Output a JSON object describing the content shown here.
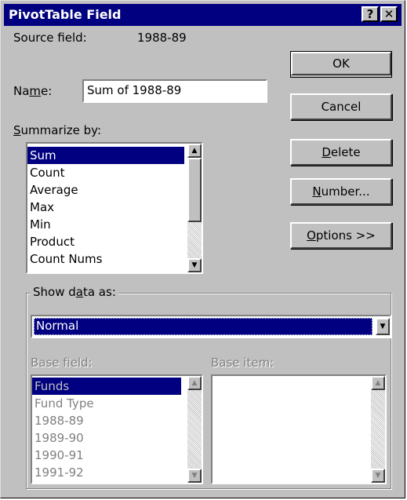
{
  "dialog": {
    "title": "PivotTable Field",
    "help_label": "?",
    "close_label": "✕"
  },
  "source": {
    "label": "Source field:",
    "value": "1988-89"
  },
  "name": {
    "label_pre": "Na",
    "label_key": "m",
    "label_post": "e:",
    "value": "Sum of 1988-89"
  },
  "summarize": {
    "label_key": "S",
    "label_post": "ummarize by:",
    "items": [
      "Sum",
      "Count",
      "Average",
      "Max",
      "Min",
      "Product",
      "Count Nums"
    ],
    "selected": "Sum"
  },
  "buttons": {
    "ok": "OK",
    "cancel": "Cancel",
    "delete_key": "D",
    "delete_rest": "elete",
    "number_key": "N",
    "number_rest": "umber...",
    "options_key": "O",
    "options_rest": "ptions >>"
  },
  "show_data": {
    "label_pre": "Show d",
    "label_key": "a",
    "label_post": "ta as:",
    "selected": "Normal"
  },
  "base_field": {
    "label": "Base field:",
    "items": [
      "Funds",
      "Fund Type",
      "1988-89",
      "1989-90",
      "1990-91",
      "1991-92"
    ],
    "selected": "Funds"
  },
  "base_item": {
    "label": "Base item:"
  },
  "colors": {
    "title_bar": "#000080",
    "face": "#c0c0c0",
    "selection": "#000080"
  },
  "icons": {
    "scroll_up": "triangle-up",
    "scroll_down": "triangle-down",
    "dropdown": "triangle-down"
  }
}
